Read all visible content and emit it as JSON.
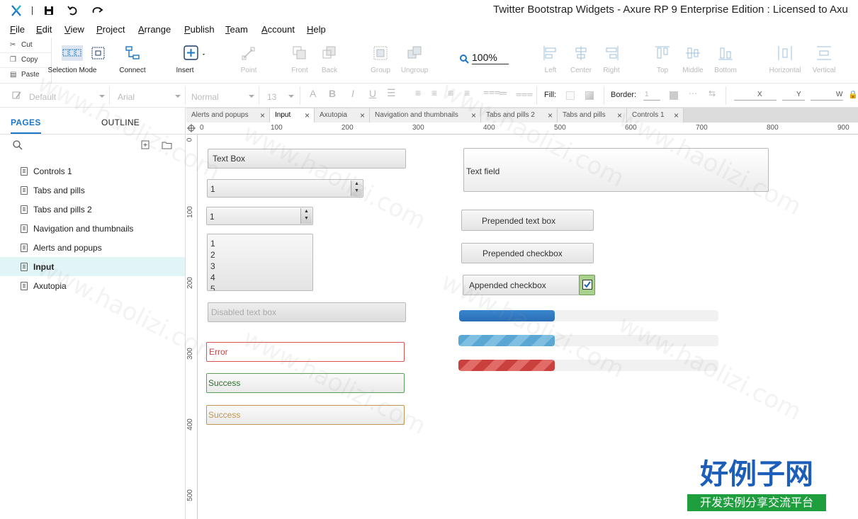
{
  "window": {
    "title": "Twitter Bootstrap Widgets - Axure RP 9 Enterprise Edition : Licensed to Axu"
  },
  "menu": [
    "File",
    "Edit",
    "View",
    "Project",
    "Arrange",
    "Publish",
    "Team",
    "Account",
    "Help"
  ],
  "clipboard": {
    "cut": "Cut",
    "copy": "Copy",
    "paste": "Paste"
  },
  "tools": {
    "selection_mode": "Selection Mode",
    "connect": "Connect",
    "insert": "Insert",
    "point": "Point",
    "front": "Front",
    "back": "Back",
    "group": "Group",
    "ungroup": "Ungroup",
    "zoom": "100%",
    "left": "Left",
    "center": "Center",
    "right": "Right",
    "top": "Top",
    "middle": "Middle",
    "bottom": "Bottom",
    "horizontal": "Horizontal",
    "vertical": "Vertical"
  },
  "format": {
    "style": "Default",
    "font": "Arial",
    "weight": "Normal",
    "size": "13",
    "fill_label": "Fill:",
    "border_label": "Border:",
    "border_value": "1",
    "x_label": "X",
    "y_label": "Y",
    "w_label": "W"
  },
  "panel": {
    "tabs": {
      "pages": "PAGES",
      "outline": "OUTLINE"
    },
    "pages": [
      "Controls 1",
      "Tabs and pills",
      "Tabs and pills 2",
      "Navigation and thumbnails",
      "Alerts and popups",
      "Input",
      "Axutopia"
    ],
    "selected": "Input"
  },
  "doc_tabs": [
    "Alerts and popups",
    "Input",
    "Axutopia",
    "Navigation and thumbnails",
    "Tabs and pills 2",
    "Tabs and pills",
    "Controls 1"
  ],
  "active_doc_tab": "Input",
  "ruler": {
    "h": [
      "0",
      "100",
      "200",
      "300",
      "400",
      "500",
      "600",
      "700",
      "800",
      "900"
    ],
    "v": [
      "0",
      "100",
      "200",
      "300",
      "400",
      "500"
    ]
  },
  "canvas": {
    "text_box": "Text Box",
    "spinner1": "1",
    "spinner2": "1",
    "listbox": [
      "1",
      "2",
      "3",
      "4",
      "5"
    ],
    "disabled": "Disabled text box",
    "error": "Error",
    "success1": "Success",
    "success2": "Success",
    "text_field": "Text field",
    "prepended_text": "Prepended text box",
    "prepended_check": "Prepended checkbox",
    "appended_check": "Appended checkbox",
    "progress": [
      0.37,
      0.37,
      0.37
    ]
  },
  "watermark": {
    "text": "www.haolizi.com",
    "logo_title": "好例子网",
    "logo_sub": "开发实例分享交流平台"
  },
  "colors": {
    "accent": "#1a77c9",
    "logo_green": "#1e9e3d",
    "logo_blue": "#1d5fb8",
    "error": "#d9534f",
    "success": "#5aa15a",
    "warning": "#c09853"
  }
}
